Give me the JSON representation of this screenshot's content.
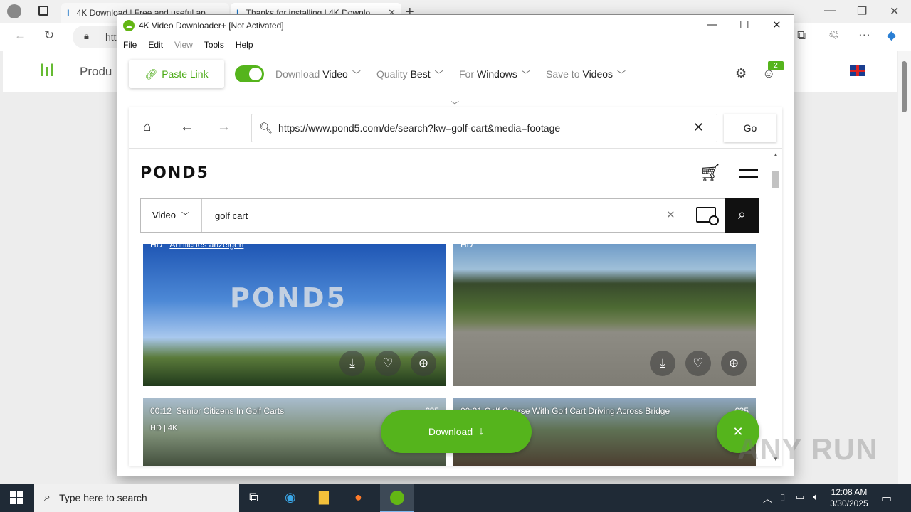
{
  "browser": {
    "tabs": [
      {
        "label": "4K Download | Free and useful ap"
      },
      {
        "label": "Thanks for installing | 4K Downlo"
      }
    ],
    "address_partial": "htt",
    "page_product_label": "Produ"
  },
  "app": {
    "title": "4K Video Downloader+ [Not Activated]",
    "menu": [
      "File",
      "Edit",
      "View",
      "Tools",
      "Help"
    ],
    "toolbar": {
      "paste_link": "Paste Link",
      "download_label": "Download",
      "download_value": "Video",
      "quality_label": "Quality",
      "quality_value": "Best",
      "for_label": "For",
      "for_value": "Windows",
      "save_label": "Save to",
      "save_value": "Videos",
      "notifications_count": "2"
    },
    "embedded_browser": {
      "url": "https://www.pond5.com/de/search?kw=golf-cart&media=footage",
      "go_label": "Go"
    },
    "site": {
      "logo": "POND5",
      "search_type": "Video",
      "search_query": "golf cart",
      "cards": [
        {
          "badge": "HD",
          "link": "Ähnliches anzeigen",
          "watermark": "POND5"
        },
        {
          "badge": "HD"
        },
        {
          "time": "00:12",
          "title": "Senior Citizens In Golf Carts",
          "meta": "HD | 4K",
          "price": "€35"
        },
        {
          "time": "00:21",
          "title": "Golf Course With Golf Cart Driving Across Bridge",
          "price": "€35"
        }
      ]
    },
    "download_button": "Download"
  },
  "watermark": "ANY RUN",
  "taskbar": {
    "search_placeholder": "Type here to search",
    "time": "12:08 AM",
    "date": "3/30/2025"
  },
  "colors": {
    "accent": "#55b41c",
    "taskbar": "#1f2a36"
  }
}
